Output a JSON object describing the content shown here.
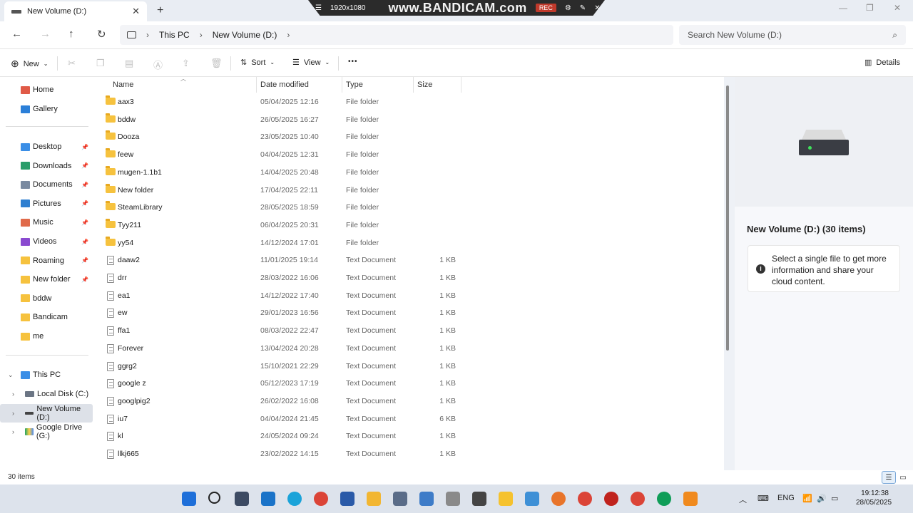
{
  "window": {
    "tab_title": "New Volume (D:)",
    "tab_close": "✕",
    "new_tab": "+"
  },
  "overlay": {
    "resolution": "1920x1080",
    "brand": "www.BANDICAM.com",
    "rec": "REC"
  },
  "address": {
    "crumbs": [
      "This PC",
      "New Volume (D:)"
    ],
    "search_placeholder": "Search New Volume (D:)"
  },
  "toolbar": {
    "new_label": "New",
    "sort_label": "Sort",
    "view_label": "View",
    "more_label": "•••",
    "details_label": "Details"
  },
  "sidebar": {
    "quick": [
      {
        "label": "Home",
        "color": "#e05a47"
      },
      {
        "label": "Gallery",
        "color": "#2b7fd8"
      }
    ],
    "pinned": [
      {
        "label": "Desktop",
        "color": "#3a8ee6"
      },
      {
        "label": "Downloads",
        "color": "#2a9d6a"
      },
      {
        "label": "Documents",
        "color": "#7a8aa0"
      },
      {
        "label": "Pictures",
        "color": "#2f7fd0"
      },
      {
        "label": "Music",
        "color": "#e06a4a"
      },
      {
        "label": "Videos",
        "color": "#8a4ad0"
      },
      {
        "label": "Roaming",
        "color": "#f6c23e"
      },
      {
        "label": "New folder",
        "color": "#f6c23e"
      },
      {
        "label": "bddw",
        "color": "#f6c23e"
      },
      {
        "label": "Bandicam",
        "color": "#f6c23e"
      },
      {
        "label": "me",
        "color": "#f6c23e"
      }
    ],
    "this_pc": "This PC",
    "drives": [
      "Local Disk (C:)",
      "New Volume (D:)",
      "Google Drive (G:)"
    ]
  },
  "columns": {
    "name": "Name",
    "date": "Date modified",
    "type": "Type",
    "size": "Size"
  },
  "files": [
    {
      "name": "aax3",
      "date": "05/04/2025 12:16",
      "type": "File folder",
      "size": "",
      "kind": "folder"
    },
    {
      "name": "bddw",
      "date": "26/05/2025 16:27",
      "type": "File folder",
      "size": "",
      "kind": "folder"
    },
    {
      "name": "Dooza",
      "date": "23/05/2025 10:40",
      "type": "File folder",
      "size": "",
      "kind": "folder"
    },
    {
      "name": "feew",
      "date": "04/04/2025 12:31",
      "type": "File folder",
      "size": "",
      "kind": "folder"
    },
    {
      "name": "mugen-1.1b1",
      "date": "14/04/2025 20:48",
      "type": "File folder",
      "size": "",
      "kind": "folder"
    },
    {
      "name": "New folder",
      "date": "17/04/2025 22:11",
      "type": "File folder",
      "size": "",
      "kind": "folder"
    },
    {
      "name": "SteamLibrary",
      "date": "28/05/2025 18:59",
      "type": "File folder",
      "size": "",
      "kind": "folder"
    },
    {
      "name": "Tyy211",
      "date": "06/04/2025 20:31",
      "type": "File folder",
      "size": "",
      "kind": "folder"
    },
    {
      "name": "yy54",
      "date": "14/12/2024 17:01",
      "type": "File folder",
      "size": "",
      "kind": "folder"
    },
    {
      "name": "daaw2",
      "date": "11/01/2025 19:14",
      "type": "Text Document",
      "size": "1 KB",
      "kind": "doc"
    },
    {
      "name": "drr",
      "date": "28/03/2022 16:06",
      "type": "Text Document",
      "size": "1 KB",
      "kind": "doc"
    },
    {
      "name": "ea1",
      "date": "14/12/2022 17:40",
      "type": "Text Document",
      "size": "1 KB",
      "kind": "doc"
    },
    {
      "name": "ew",
      "date": "29/01/2023 16:56",
      "type": "Text Document",
      "size": "1 KB",
      "kind": "doc"
    },
    {
      "name": "ffa1",
      "date": "08/03/2022 22:47",
      "type": "Text Document",
      "size": "1 KB",
      "kind": "doc"
    },
    {
      "name": "Forever",
      "date": "13/04/2024 20:28",
      "type": "Text Document",
      "size": "1 KB",
      "kind": "doc"
    },
    {
      "name": "ggrg2",
      "date": "15/10/2021 22:29",
      "type": "Text Document",
      "size": "1 KB",
      "kind": "doc"
    },
    {
      "name": "google z",
      "date": "05/12/2023 17:19",
      "type": "Text Document",
      "size": "1 KB",
      "kind": "doc"
    },
    {
      "name": "googlpig2",
      "date": "26/02/2022 16:08",
      "type": "Text Document",
      "size": "1 KB",
      "kind": "doc"
    },
    {
      "name": "iu7",
      "date": "04/04/2024 21:45",
      "type": "Text Document",
      "size": "6 KB",
      "kind": "doc"
    },
    {
      "name": "kl",
      "date": "24/05/2024 09:24",
      "type": "Text Document",
      "size": "1 KB",
      "kind": "doc"
    },
    {
      "name": "llkj665",
      "date": "23/02/2022 14:15",
      "type": "Text Document",
      "size": "1 KB",
      "kind": "doc"
    }
  ],
  "details": {
    "title": "New Volume (D:) (30 items)",
    "message": "Select a single file to get more information and share your cloud content."
  },
  "status": {
    "count": "30 items"
  },
  "taskbar": {
    "lang": "ENG",
    "time": "19:12:38",
    "date": "28/05/2025",
    "apps": [
      {
        "name": "start-icon",
        "color": "#1e6fd9"
      },
      {
        "name": "search-icon",
        "color": "#222222"
      },
      {
        "name": "task-view-icon",
        "color": "#3d4b63"
      },
      {
        "name": "store-icon",
        "color": "#1a73c8"
      },
      {
        "name": "edge-icon",
        "color": "#1aa3d9"
      },
      {
        "name": "chrome-icon",
        "color": "#db4437"
      },
      {
        "name": "terminal-icon",
        "color": "#2a5aa8"
      },
      {
        "name": "explorer-icon",
        "color": "#f2b632"
      },
      {
        "name": "settings-icon",
        "color": "#5a6c88"
      },
      {
        "name": "calculator-icon",
        "color": "#3e7cc8"
      },
      {
        "name": "tool-icon",
        "color": "#8a8a8a"
      },
      {
        "name": "clock-icon",
        "color": "#444444"
      },
      {
        "name": "player-icon",
        "color": "#f5c22e"
      },
      {
        "name": "globe-icon",
        "color": "#3e90d6"
      },
      {
        "name": "firefox-icon",
        "color": "#e8742a"
      },
      {
        "name": "chrome-alt-icon",
        "color": "#db4437"
      },
      {
        "name": "record-icon",
        "color": "#c0231d"
      },
      {
        "name": "chrome-2-icon",
        "color": "#db4437"
      },
      {
        "name": "chrome-3-icon",
        "color": "#0f9d58"
      },
      {
        "name": "vlc-icon",
        "color": "#f08a1e"
      }
    ]
  }
}
